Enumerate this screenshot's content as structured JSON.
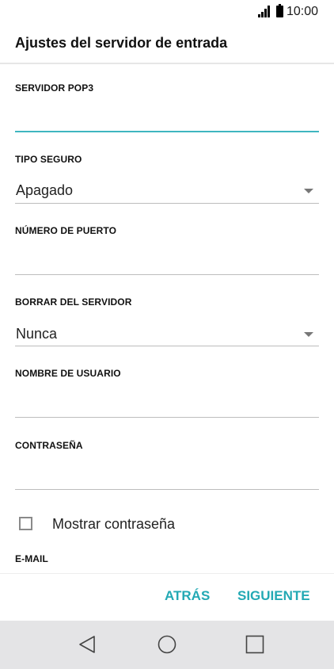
{
  "status_bar": {
    "time": "10:00",
    "icons": [
      "signal-icon",
      "battery-icon"
    ]
  },
  "page": {
    "title": "Ajustes del servidor de entrada"
  },
  "form": {
    "pop3_server": {
      "label": "SERVIDOR POP3",
      "value": "",
      "placeholder": ""
    },
    "security_type": {
      "label": "TIPO SEGURO",
      "selected": "Apagado"
    },
    "port_number": {
      "label": "NÚMERO DE PUERTO",
      "value": "",
      "placeholder": ""
    },
    "delete_from_server": {
      "label": "BORRAR DEL SERVIDOR",
      "selected": "Nunca"
    },
    "username": {
      "label": "NOMBRE DE USUARIO",
      "value": "",
      "placeholder": ""
    },
    "password": {
      "label": "CONTRASEÑA",
      "value": "",
      "placeholder": ""
    },
    "show_password": {
      "label": "Mostrar contraseña",
      "checked": false
    },
    "email": {
      "label": "E-MAIL"
    }
  },
  "actions": {
    "back_label": "ATRÁS",
    "next_label": "SIGUIENTE"
  },
  "colors": {
    "accent": "#23a9b4",
    "focused_underline": "#3fb6c0",
    "nav_bar_bg": "#e4e4e6"
  },
  "nav_bar": {
    "icons": [
      "back-triangle-icon",
      "home-circle-icon",
      "recents-square-icon"
    ]
  }
}
